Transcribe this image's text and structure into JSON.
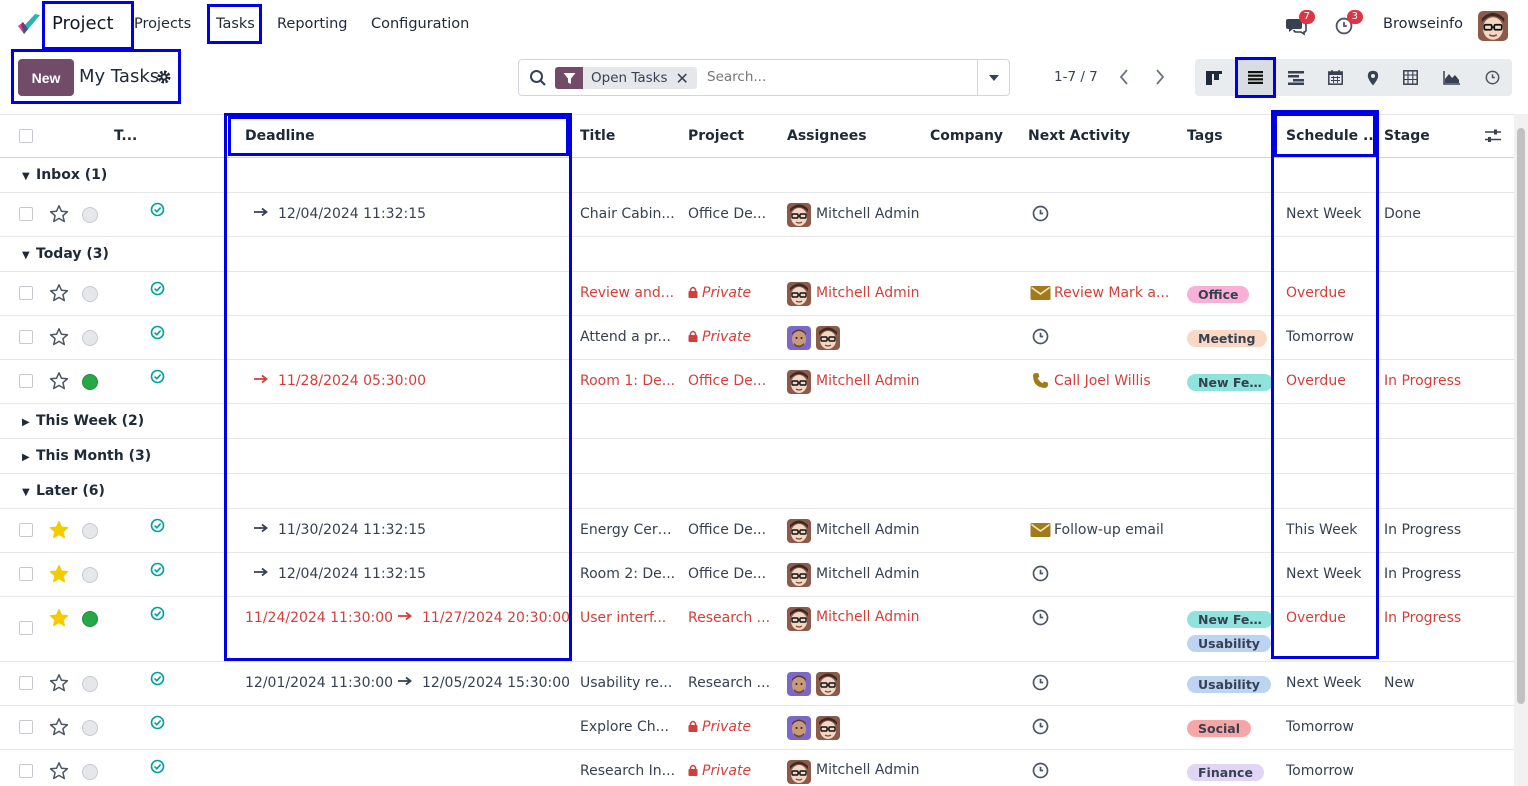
{
  "navbar": {
    "app_name": "Project",
    "menu": [
      "Projects",
      "Tasks",
      "Reporting",
      "Configuration"
    ],
    "messages_count": "7",
    "activities_count": "3",
    "user": "Browseinfo"
  },
  "control": {
    "new_label": "New",
    "title": "My Tasks",
    "facet": "Open Tasks",
    "search_placeholder": "Search...",
    "pager": "1-7 / 7"
  },
  "columns": {
    "title_short": "T...",
    "deadline": "Deadline",
    "title": "Title",
    "project": "Project",
    "assignees": "Assignees",
    "company": "Company",
    "next_activity": "Next Activity",
    "tags": "Tags",
    "schedule": "Schedule ...",
    "stage": "Stage"
  },
  "groups": {
    "inbox": "Inbox (1)",
    "today": "Today (3)",
    "this_week": "This Week (2)",
    "this_month": "This Month (3)",
    "later": "Later (6)"
  },
  "rows": [
    {
      "deadline_end": "12/04/2024 11:32:15",
      "title": "Chair Cabin...",
      "project": "Office De...",
      "assignee": "Mitchell Admin",
      "activity": "",
      "tags": [],
      "schedule": "Next Week",
      "stage": "Done"
    },
    {
      "title": "Review and...",
      "project": "Private",
      "assignee": "Mitchell Admin",
      "activity": "Review Mark a...",
      "tags": [
        "Office"
      ],
      "schedule": "Overdue",
      "stage": ""
    },
    {
      "title": "Attend a pr...",
      "project": "Private",
      "assignee": "",
      "activity": "",
      "tags": [
        "Meeting"
      ],
      "schedule": "Tomorrow",
      "stage": ""
    },
    {
      "deadline_end": "11/28/2024 05:30:00",
      "title": "Room 1: De...",
      "project": "Office De...",
      "assignee": "Mitchell Admin",
      "activity": "Call Joel Willis",
      "tags": [
        "New Fea..."
      ],
      "schedule": "Overdue",
      "stage": "In Progress"
    },
    {
      "deadline_end": "11/30/2024 11:32:15",
      "title": "Energy Cert...",
      "project": "Office De...",
      "assignee": "Mitchell Admin",
      "activity": "Follow-up email",
      "tags": [],
      "schedule": "This Week",
      "stage": "In Progress"
    },
    {
      "deadline_end": "12/04/2024 11:32:15",
      "title": "Room 2: De...",
      "project": "Office De...",
      "assignee": "Mitchell Admin",
      "activity": "",
      "tags": [],
      "schedule": "Next Week",
      "stage": "In Progress"
    },
    {
      "deadline_start": "11/24/2024 11:30:00",
      "deadline_end": "11/27/2024 20:30:00",
      "title": "User interf...",
      "project": "Research ...",
      "assignee": "Mitchell Admin",
      "activity": "",
      "tags": [
        "New Fea...",
        "Usability"
      ],
      "schedule": "Overdue",
      "stage": "In Progress"
    },
    {
      "deadline_start": "12/01/2024 11:30:00",
      "deadline_end": "12/05/2024 15:30:00",
      "title": "Usability re...",
      "project": "Research ...",
      "assignee": "",
      "activity": "",
      "tags": [
        "Usability"
      ],
      "schedule": "Next Week",
      "stage": "New"
    },
    {
      "title": "Explore Ch...",
      "project": "Private",
      "assignee": "",
      "activity": "",
      "tags": [
        "Social"
      ],
      "schedule": "Tomorrow",
      "stage": ""
    },
    {
      "title": "Research In...",
      "project": "Private",
      "assignee": "Mitchell Admin",
      "activity": "",
      "tags": [
        "Finance"
      ],
      "schedule": "Tomorrow",
      "stage": ""
    }
  ],
  "colors": {
    "brand": "#714b67",
    "overdue": "#d23f3a",
    "highlight": "#0000e6",
    "tag_office": "#f9b0d8",
    "tag_meeting": "#f9d9c6",
    "tag_newfeature": "#8ee3dc",
    "tag_usability": "#bcd4f2",
    "tag_social": "#f6a6a6",
    "tag_finance": "#e1d5f5"
  }
}
